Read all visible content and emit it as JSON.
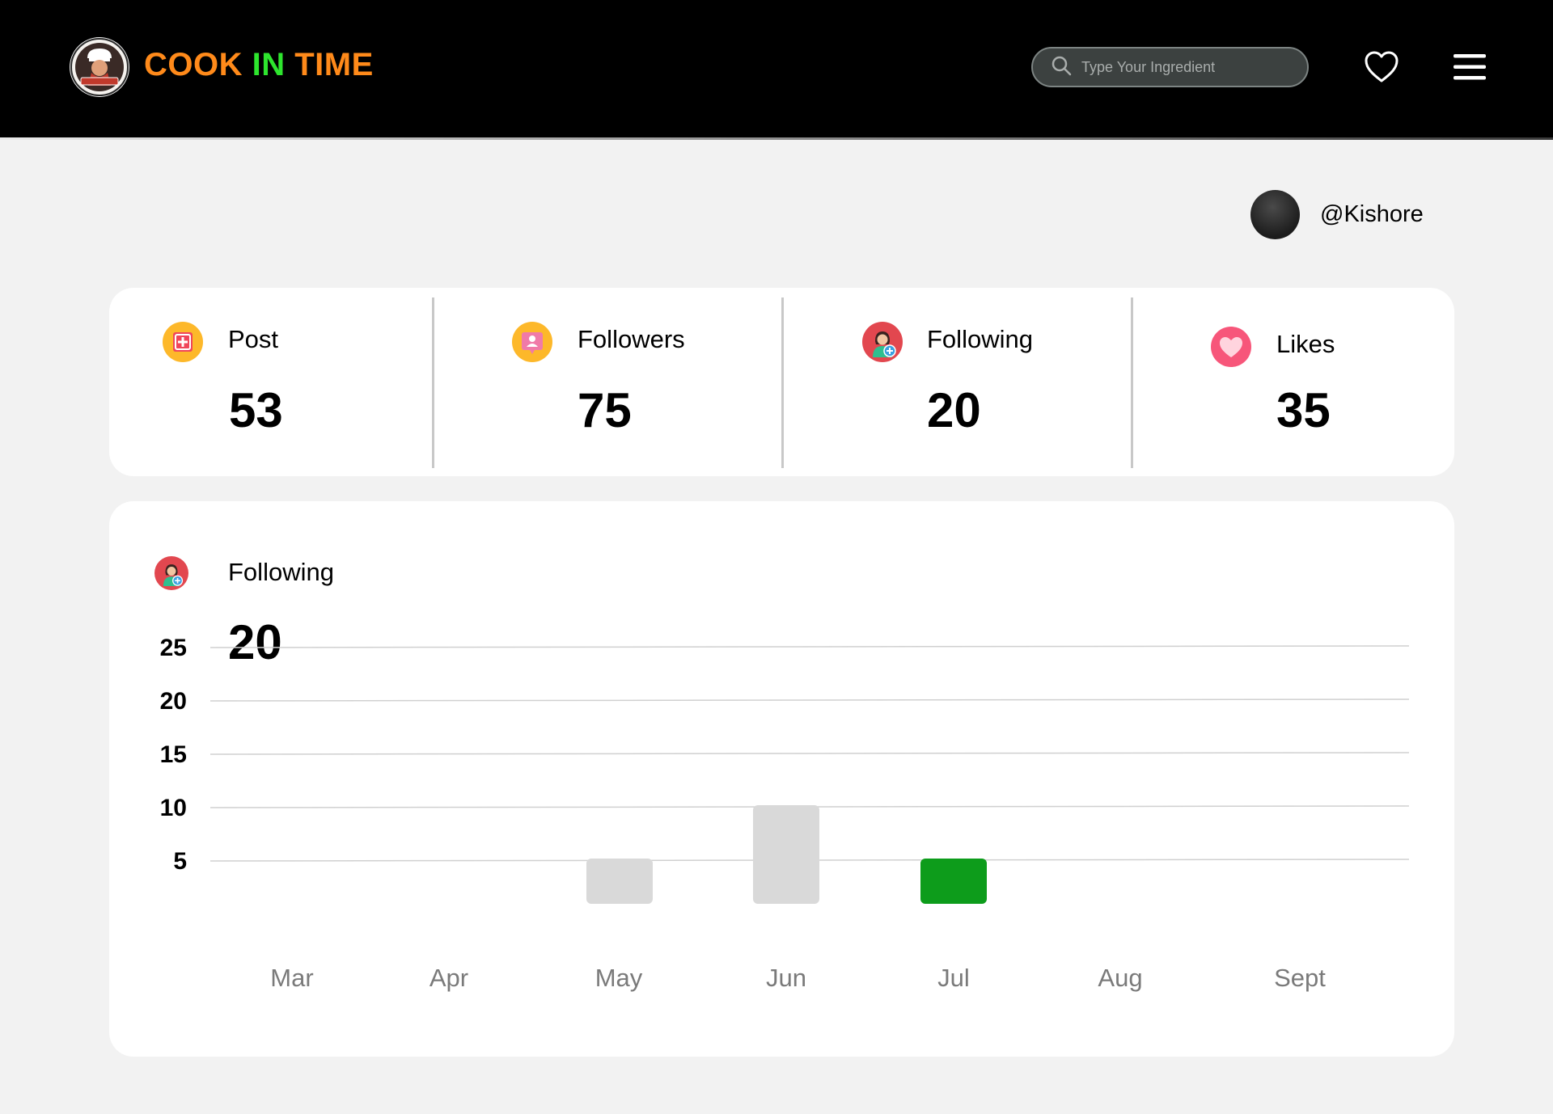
{
  "header": {
    "brand": {
      "part1": "COOK ",
      "part2": "IN",
      "part3": " TIME"
    },
    "search_placeholder": "Type Your Ingredient",
    "icons": {
      "logo": "chef-logo-icon",
      "search": "search-icon",
      "favorites": "heart-icon",
      "menu": "hamburger-menu-icon"
    }
  },
  "profile": {
    "username": "@Kishore"
  },
  "stats": [
    {
      "label": "Post",
      "value": "53",
      "icon": "add-post-icon"
    },
    {
      "label": "Followers",
      "value": "75",
      "icon": "followers-icon"
    },
    {
      "label": "Following",
      "value": "20",
      "icon": "following-user-icon"
    },
    {
      "label": "Likes",
      "value": "35",
      "icon": "likes-heart-icon"
    }
  ],
  "chart_section": {
    "label": "Following",
    "value": "20",
    "icon": "following-user-icon"
  },
  "chart_data": {
    "type": "bar",
    "categories": [
      "Mar",
      "Apr",
      "May",
      "Jun",
      "Jul",
      "Aug",
      "Sept"
    ],
    "values": [
      0,
      0,
      5,
      10,
      5,
      0,
      0
    ],
    "highlight_index": 4,
    "yticks": [
      5,
      10,
      15,
      20,
      25
    ],
    "ylim": [
      0,
      25
    ],
    "grid": true,
    "colors": {
      "bar": "#d9d9d9",
      "highlight": "#0d9c1b",
      "grid": "#d0d0d0",
      "xtick": "#7a7a7a"
    }
  },
  "colors": {
    "brand_orange": "#ff8a1a",
    "brand_green": "#2ee52e",
    "header_bg": "#000000",
    "page_bg": "#f2f2f2"
  }
}
